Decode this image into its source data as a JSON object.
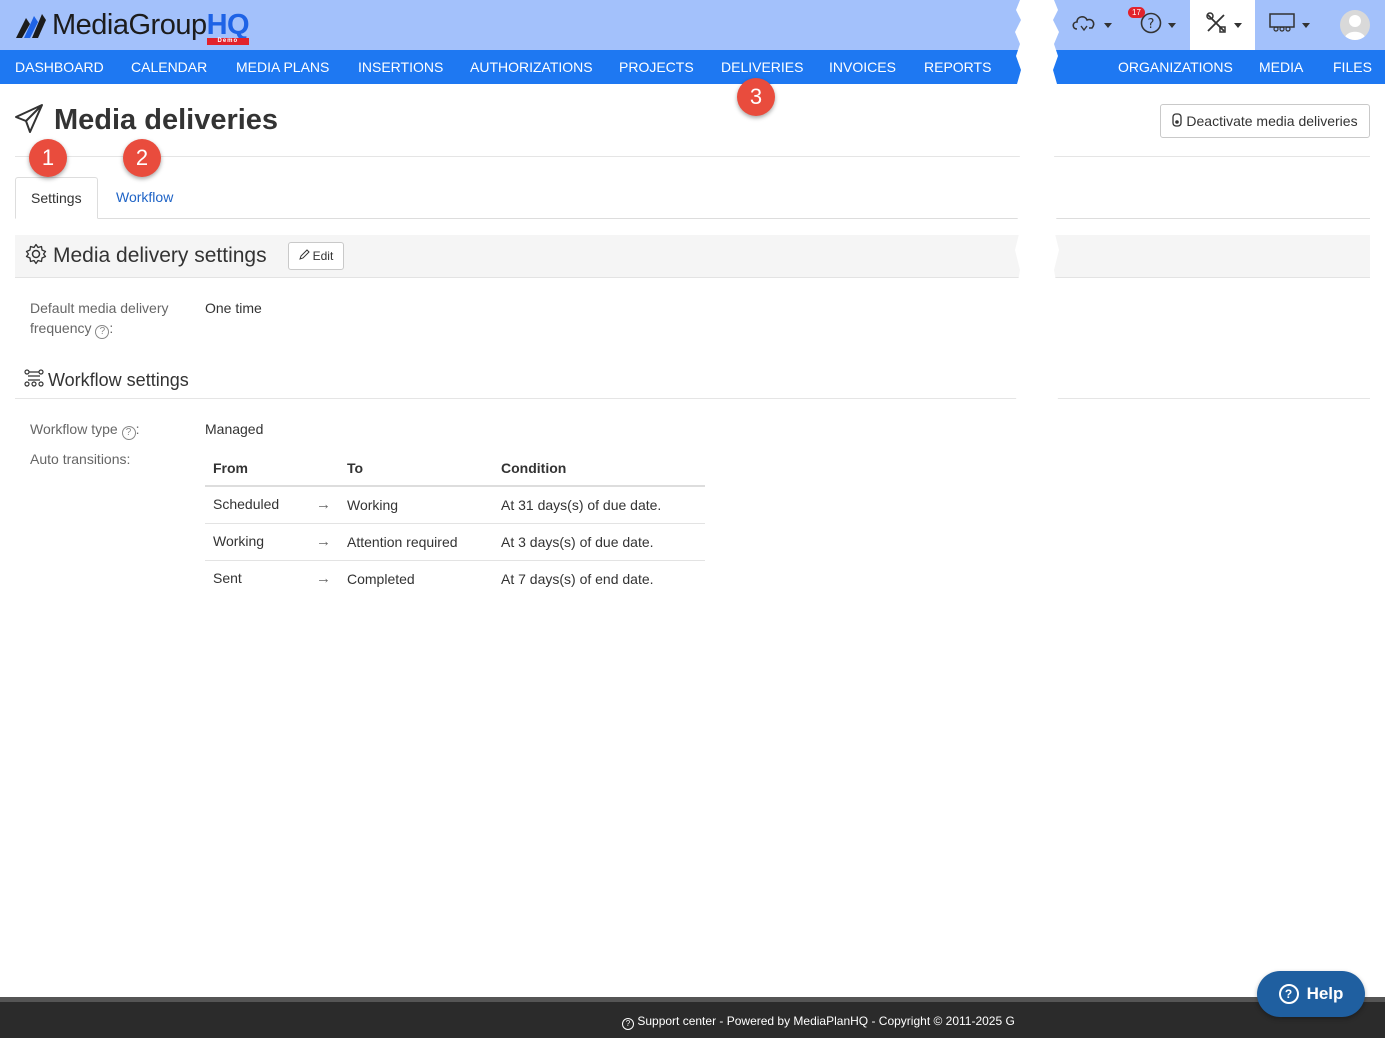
{
  "header": {
    "logo_text": "MediaGroup",
    "logo_hq": "HQ",
    "logo_tag": "Demo",
    "notification_count": "17"
  },
  "nav": {
    "left": [
      "DASHBOARD",
      "CALENDAR",
      "MEDIA PLANS",
      "INSERTIONS",
      "AUTHORIZATIONS",
      "PROJECTS",
      "DELIVERIES",
      "INVOICES",
      "REPORTS"
    ],
    "right": [
      "ORGANIZATIONS",
      "MEDIA",
      "FILES"
    ]
  },
  "page": {
    "title": "Media deliveries",
    "deactivate_label": "Deactivate media deliveries"
  },
  "tabs": [
    "Settings",
    "Workflow"
  ],
  "delivery_settings": {
    "heading": "Media delivery settings",
    "edit_label": "Edit",
    "frequency_label_1": "Default media delivery",
    "frequency_label_2": "frequency",
    "frequency_value": "One time"
  },
  "workflow_settings": {
    "heading": "Workflow settings",
    "type_label": "Workflow type",
    "type_value": "Managed",
    "auto_label": "Auto transitions:",
    "columns": [
      "From",
      "To",
      "Condition"
    ],
    "rows": [
      {
        "from": "Scheduled",
        "to": "Working",
        "condition": "At 31 days(s) of due date."
      },
      {
        "from": "Working",
        "to": "Attention required",
        "condition": "At 3 days(s) of due date."
      },
      {
        "from": "Sent",
        "to": "Completed",
        "condition": "At 7 days(s) of end date."
      }
    ]
  },
  "markers": [
    "1",
    "2",
    "3"
  ],
  "footer": {
    "text": "Support center - Powered by MediaPlanHQ - Copyright © 2011-2025 G"
  },
  "help_button": "Help",
  "colors": {
    "header_bg": "#a3c1fb",
    "nav_bg": "#1e78f2",
    "marker": "#e94c3d",
    "help_button": "#1f5fa0"
  }
}
